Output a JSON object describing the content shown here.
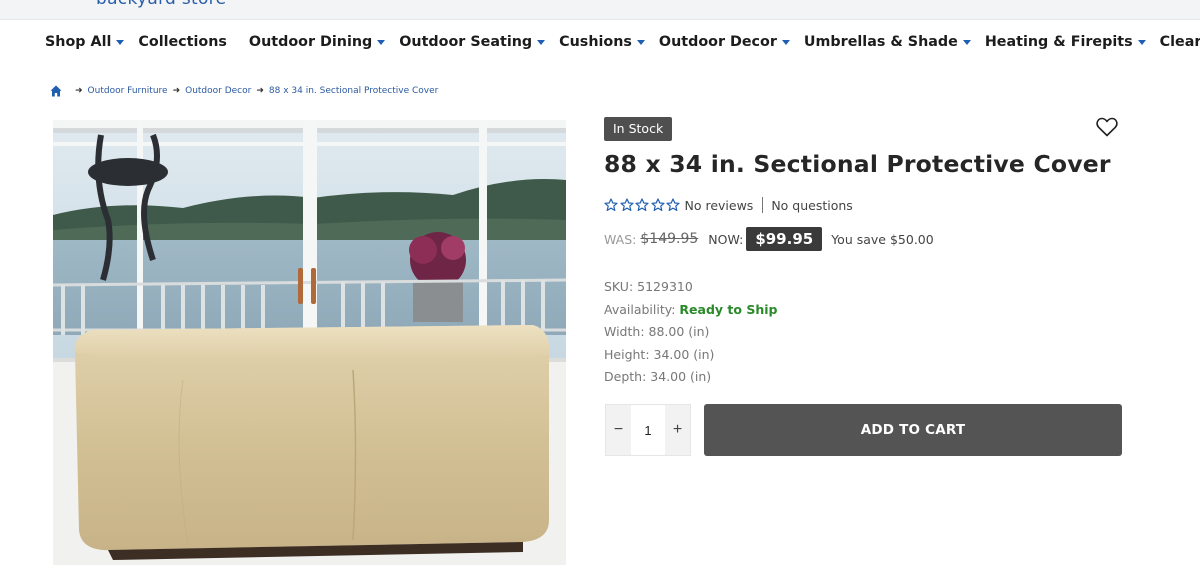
{
  "header": {
    "logo_text": "backyard store"
  },
  "nav": {
    "items": [
      {
        "label": "Shop All",
        "caret": true
      },
      {
        "label": "Collections",
        "caret": false
      },
      {
        "label": "Outdoor Dining",
        "caret": true
      },
      {
        "label": "Outdoor Seating",
        "caret": true
      },
      {
        "label": "Cushions",
        "caret": true
      },
      {
        "label": "Outdoor Decor",
        "caret": true
      },
      {
        "label": "Umbrellas & Shade",
        "caret": true
      },
      {
        "label": "Heating & Firepits",
        "caret": true
      },
      {
        "label": "Clearance",
        "caret": true
      }
    ]
  },
  "breadcrumb": {
    "items": [
      "Outdoor Furniture",
      "Outdoor Decor",
      "88 x 34 in. Sectional Protective Cover"
    ]
  },
  "product": {
    "stock_badge": "In Stock",
    "title": "88 x 34 in. Sectional Protective Cover",
    "rating_stars": 0,
    "reviews_text": "No reviews",
    "questions_text": "No questions",
    "was_label": "WAS:",
    "was_price": "$149.95",
    "now_label": "NOW:",
    "now_price": "$99.95",
    "savings_text": "You save $50.00",
    "sku_label": "SKU:",
    "sku": "5129310",
    "availability_label": "Availability:",
    "availability": "Ready to Ship",
    "width_label": "Width:",
    "width": "88.00 (in)",
    "height_label": "Height:",
    "height": "34.00 (in)",
    "depth_label": "Depth:",
    "depth": "34.00 (in)",
    "quantity": "1",
    "qty_minus": "−",
    "qty_plus": "+",
    "add_to_cart_label": "ADD TO CART"
  },
  "colors": {
    "brand_blue": "#1f5fb0",
    "availability_green": "#2a8a2a",
    "button_dark": "#545454"
  },
  "icons": {
    "home": "home-icon",
    "wishlist": "heart-icon",
    "star": "star-outline-icon",
    "breadcrumb_separator": "arrow-right-icon",
    "dropdown": "caret-down-icon"
  }
}
